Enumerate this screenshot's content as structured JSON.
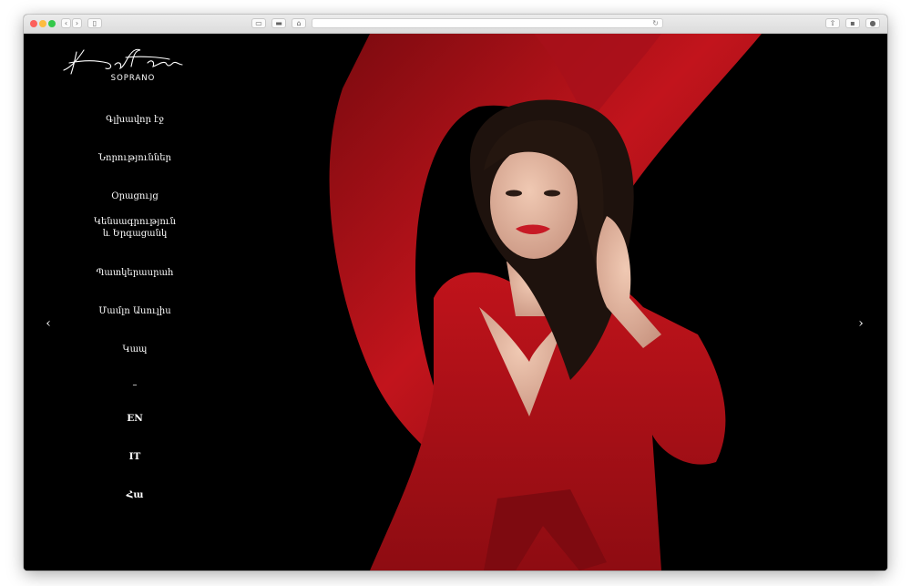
{
  "brand": {
    "logo_text": "Hasmik Torosyan",
    "subtitle": "SOPRANO"
  },
  "nav": {
    "items": [
      {
        "label": "Գլխավոր էջ"
      },
      {
        "label": "Նորություններ"
      },
      {
        "label": "Օրացույց"
      },
      {
        "label_line1": "Կենսագրություն",
        "label_line2": "և Երգացանկ"
      },
      {
        "label": "Պատկերասրահ"
      },
      {
        "label": "Մամլո Ասուլիս"
      },
      {
        "label": "Կապ"
      }
    ],
    "separator": "–",
    "languages": [
      "EN",
      "IT",
      "Հա"
    ]
  },
  "icons": {
    "prev": "chevron-left-icon",
    "next": "chevron-right-icon",
    "browser_back": "chevron-left-icon",
    "browser_forward": "chevron-right-icon",
    "sidebar": "sidebar-icon",
    "home": "home-icon",
    "reload": "reload-icon",
    "share": "share-icon",
    "download": "download-icon"
  },
  "colors": {
    "background": "#000000",
    "dress": "#b3121a",
    "text": "#ffffff"
  }
}
